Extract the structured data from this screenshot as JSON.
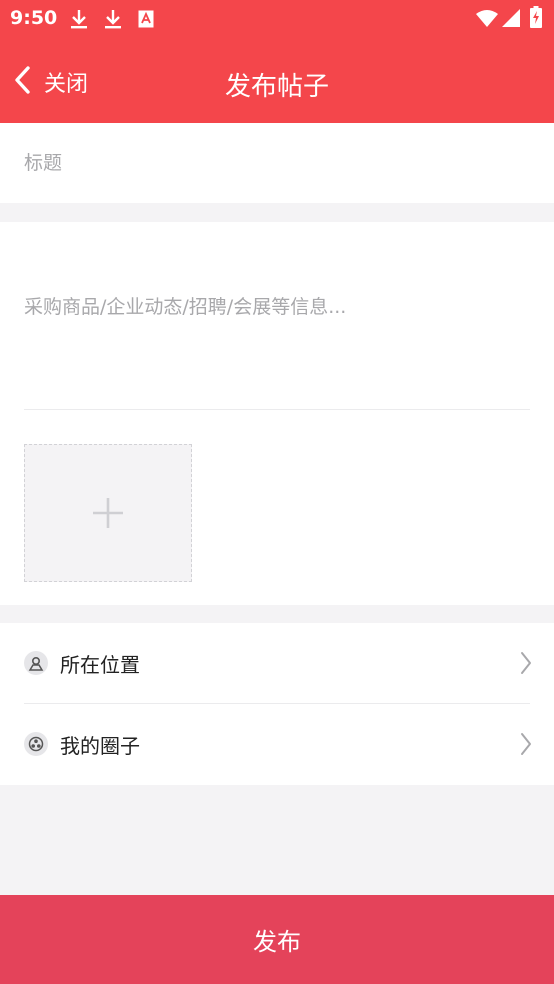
{
  "status_bar": {
    "time": "9:50",
    "left_icons": [
      "download-icon",
      "download-icon",
      "a-app-icon"
    ],
    "right_icons": [
      "wifi-icon",
      "signal-icon",
      "battery-charging-icon"
    ]
  },
  "app_bar": {
    "back_label": "关闭",
    "title": "发布帖子",
    "color": "#f4464b"
  },
  "form": {
    "title_placeholder": "标题",
    "content_placeholder": "采购商品/企业动态/招聘/会展等信息...",
    "upload_icon": "plus-icon"
  },
  "options": [
    {
      "label": "所在位置",
      "icon": "location-icon"
    },
    {
      "label": "我的圈子",
      "icon": "circle-group-icon"
    }
  ],
  "publish_label": "发布",
  "publish_color": "#e4435a"
}
